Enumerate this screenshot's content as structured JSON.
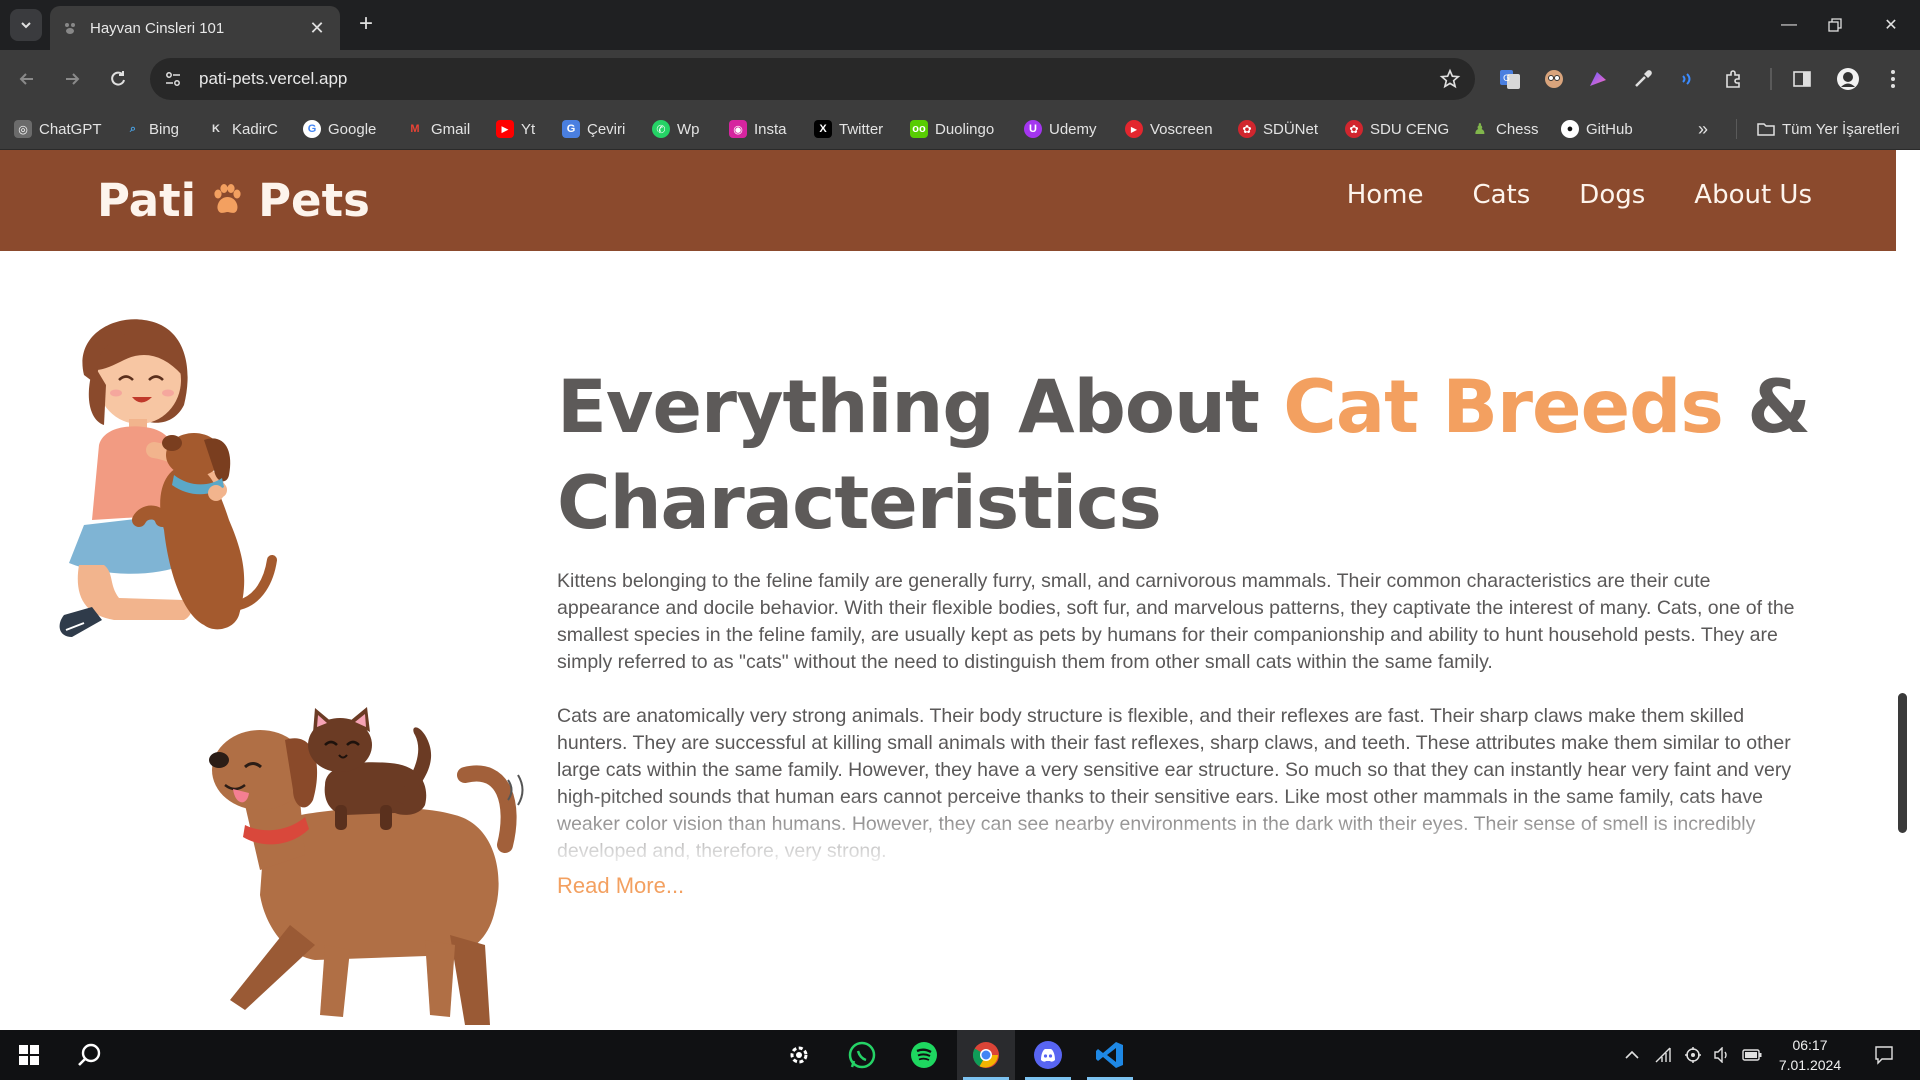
{
  "browser": {
    "tab_title": "Hayvan Cinsleri 101",
    "url": "pati-pets.vercel.app",
    "bookmarks": [
      {
        "label": "ChatGPT",
        "icon": "chatgpt-icon",
        "color": "#6b6b6b"
      },
      {
        "label": "Bing",
        "icon": "bing-search-icon",
        "color": "#3c3c3c"
      },
      {
        "label": "KadirC",
        "icon": "kadirc-icon",
        "color": "#3c3c3c"
      },
      {
        "label": "Google",
        "icon": "google-icon",
        "color": "#ffffff"
      },
      {
        "label": "Gmail",
        "icon": "gmail-icon",
        "color": "#ea4335"
      },
      {
        "label": "Yt",
        "icon": "youtube-icon",
        "color": "#ff0000"
      },
      {
        "label": "Çeviri",
        "icon": "translate-icon",
        "color": "#4a7fe0"
      },
      {
        "label": "Wp",
        "icon": "whatsapp-icon",
        "color": "#25d366"
      },
      {
        "label": "Insta",
        "icon": "instagram-icon",
        "color": "#d6249f"
      },
      {
        "label": "Twitter",
        "icon": "x-icon",
        "color": "#000000"
      },
      {
        "label": "Duolingo",
        "icon": "duolingo-icon",
        "color": "#58cc02"
      },
      {
        "label": "Udemy",
        "icon": "udemy-icon",
        "color": "#a435f0"
      },
      {
        "label": "Voscreen",
        "icon": "voscreen-icon",
        "color": "#e3262e"
      },
      {
        "label": "SDÜNet",
        "icon": "sdu-icon",
        "color": "#d1262e"
      },
      {
        "label": "SDU CENG",
        "icon": "sdu-icon",
        "color": "#d1262e"
      },
      {
        "label": "Chess",
        "icon": "chess-pawn-icon",
        "color": "#81b64c"
      },
      {
        "label": "GitHub",
        "icon": "github-icon",
        "color": "#ffffff"
      }
    ],
    "all_bookmarks": "Tüm Yer İşaretleri"
  },
  "site": {
    "logo_left": "Pati",
    "logo_right": "Pets",
    "nav": [
      "Home",
      "Cats",
      "Dogs",
      "About Us"
    ],
    "accent_color": "#f3a060",
    "header_color": "#8b4a2d"
  },
  "hero": {
    "title_part1": "Everything About ",
    "title_accent": "Cat Breeds",
    "title_part2": " & Characteristics",
    "para1": "Kittens belonging to the feline family are generally furry, small, and carnivorous mammals. Their common characteristics are their cute appearance and docile behavior. With their flexible bodies, soft fur, and marvelous patterns, they captivate the interest of many. Cats, one of the smallest species in the feline family, are usually kept as pets by humans for their companionship and ability to hunt household pests. They are simply referred to as \"cats\" without the need to distinguish them from other small cats within the same family.",
    "para2": "Cats are anatomically very strong animals. Their body structure is flexible, and their reflexes are fast. Their sharp claws make them skilled hunters. They are successful at killing small animals with their fast reflexes, sharp claws, and teeth. These attributes make them similar to other large cats within the same family. However, they have a very sensitive ear structure. So much so that they can instantly hear very faint and very high-pitched sounds that human ears cannot perceive thanks to their sensitive ears. Like most other mammals in the same family, cats have weaker color vision than humans. However, they can see nearby environments in the dark with their eyes. Their sense of smell is incredibly developed and, therefore, very strong.",
    "read_more": "Read More..."
  },
  "taskbar": {
    "time": "06:17",
    "date": "7.01.2024"
  }
}
